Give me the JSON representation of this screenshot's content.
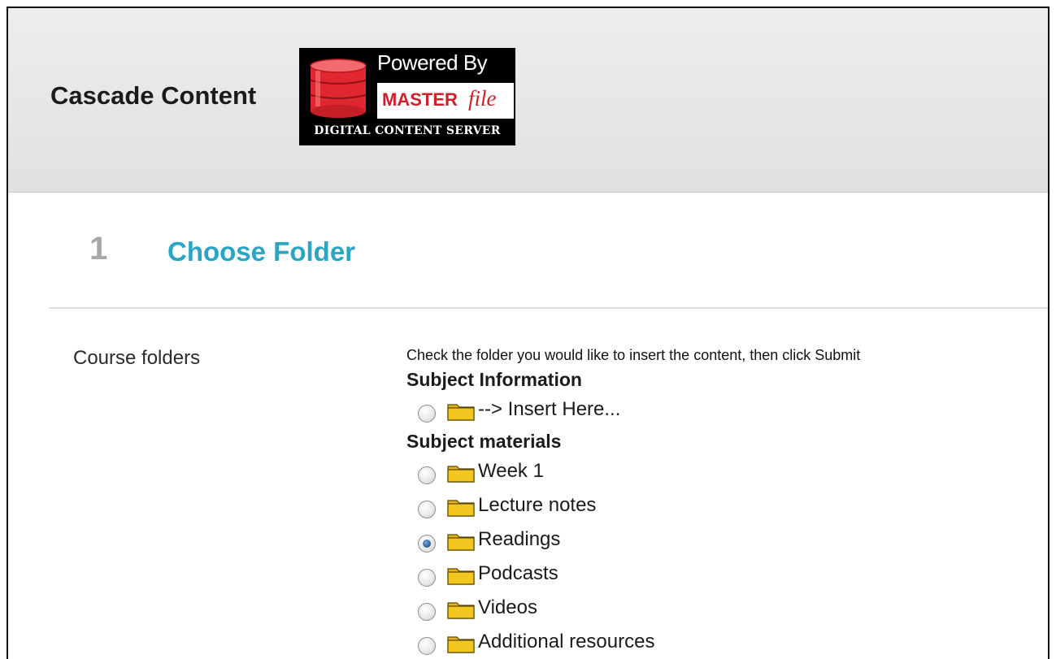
{
  "header": {
    "app_title": "Cascade Content",
    "logo": {
      "powered_by": "Powered By",
      "brand_main": "MASTER",
      "brand_script": "file",
      "subtitle": "DIGITAL CONTENT SERVER"
    }
  },
  "step": {
    "number": "1",
    "title": "Choose Folder"
  },
  "form": {
    "field_label": "Course folders",
    "instructions": "Check the folder you would like to insert the content, then click Submit",
    "groups": [
      {
        "heading": "Subject Information",
        "options": [
          {
            "label": "--> Insert Here...",
            "selected": false
          }
        ]
      },
      {
        "heading": "Subject materials",
        "options": [
          {
            "label": "Week 1",
            "selected": false
          },
          {
            "label": "Lecture notes",
            "selected": false
          },
          {
            "label": "Readings",
            "selected": true
          },
          {
            "label": "Podcasts",
            "selected": false
          },
          {
            "label": "Videos",
            "selected": false
          },
          {
            "label": "Additional resources",
            "selected": false
          }
        ]
      }
    ]
  },
  "colors": {
    "accent": "#2aa5c4",
    "header_bg": "#e6e6e6",
    "folder": "#e3b40f",
    "logo_red": "#d2202a"
  },
  "icons": {
    "folder": "folder-icon",
    "logo": "database-icon"
  }
}
